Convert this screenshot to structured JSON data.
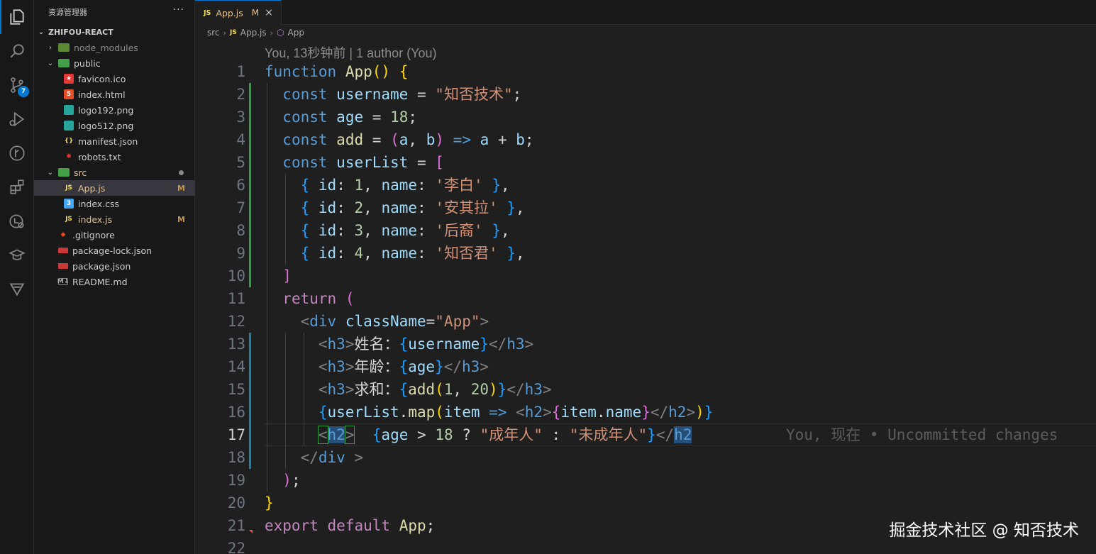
{
  "activity_bar": {
    "items": [
      {
        "name": "explorer-icon"
      },
      {
        "name": "search-icon"
      },
      {
        "name": "source-control-icon",
        "badge": "7"
      },
      {
        "name": "run-debug-icon"
      },
      {
        "name": "git-graph-icon"
      },
      {
        "name": "extensions-icon"
      },
      {
        "name": "remote-explorer-icon"
      },
      {
        "name": "learn-icon"
      },
      {
        "name": "bookmark-icon"
      }
    ]
  },
  "sidebar": {
    "title": "资源管理器",
    "more": "···",
    "project": "ZHIFOU-REACT",
    "tree": [
      {
        "label": "node_modules",
        "icon": "folder-node-icon",
        "chevron": "›",
        "depth": 1,
        "muted": true
      },
      {
        "label": "public",
        "icon": "folder-public-icon",
        "chevron": "⌄",
        "depth": 1
      },
      {
        "label": "favicon.ico",
        "icon": "favicon-icon",
        "depth": 2
      },
      {
        "label": "index.html",
        "icon": "html-icon",
        "depth": 2
      },
      {
        "label": "logo192.png",
        "icon": "image-icon",
        "depth": 2
      },
      {
        "label": "logo512.png",
        "icon": "image-icon",
        "depth": 2
      },
      {
        "label": "manifest.json",
        "icon": "json-icon",
        "depth": 2
      },
      {
        "label": "robots.txt",
        "icon": "robots-icon",
        "depth": 2
      },
      {
        "label": "src",
        "icon": "folder-src-icon",
        "chevron": "⌄",
        "depth": 1,
        "dot": true
      },
      {
        "label": "App.js",
        "icon": "js-icon",
        "depth": 2,
        "status": "M",
        "selected": true
      },
      {
        "label": "index.css",
        "icon": "css-icon",
        "depth": 2
      },
      {
        "label": "index.js",
        "icon": "js-icon",
        "depth": 2,
        "status": "M"
      },
      {
        "label": ".gitignore",
        "icon": "git-icon",
        "depth": 1
      },
      {
        "label": "package-lock.json",
        "icon": "npm-icon",
        "depth": 1
      },
      {
        "label": "package.json",
        "icon": "npm-icon",
        "depth": 1
      },
      {
        "label": "README.md",
        "icon": "markdown-icon",
        "depth": 1
      }
    ]
  },
  "tab": {
    "js_badge": "JS",
    "name": "App.js",
    "status": "M",
    "close": "×"
  },
  "breadcrumbs": {
    "folder": "src",
    "js_badge": "JS",
    "file": "App.js",
    "symbol": "App"
  },
  "editor": {
    "blame_header": "You, 13秒钟前 | 1 author (You)",
    "current_line": 17,
    "inline_blame": "You, 现在 • Uncommitted changes",
    "line_numbers": [
      "1",
      "2",
      "3",
      "4",
      "5",
      "6",
      "7",
      "8",
      "9",
      "10",
      "11",
      "12",
      "13",
      "14",
      "15",
      "16",
      "17",
      "18",
      "19",
      "20",
      "21",
      "22"
    ]
  },
  "watermark": "掘金技术社区 @ 知否技术"
}
